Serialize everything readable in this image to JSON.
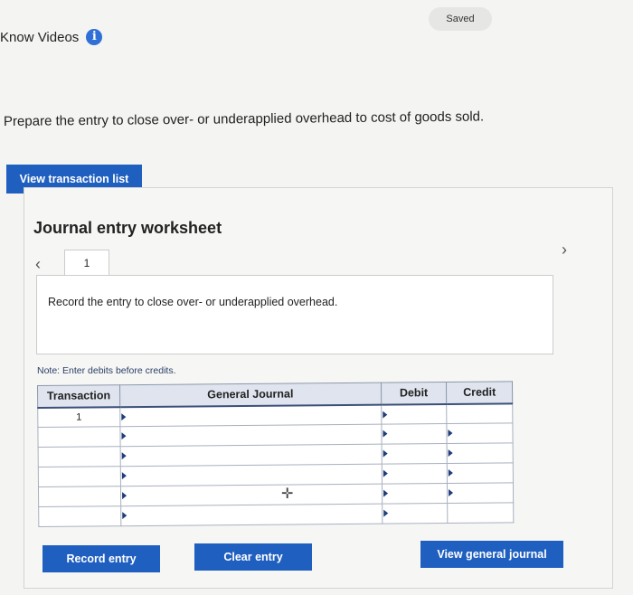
{
  "header": {
    "saved_label": "Saved",
    "know_videos_label": "Know Videos",
    "info_icon": "info-icon"
  },
  "question": {
    "prompt": "Prepare the entry to close over- or underapplied overhead to cost of goods sold."
  },
  "buttons": {
    "view_transaction_list": "View transaction list",
    "record_entry": "Record entry",
    "clear_entry": "Clear entry",
    "view_general_journal": "View general journal"
  },
  "worksheet": {
    "title": "Journal entry worksheet",
    "prev_icon": "chevron-left-icon",
    "next_icon": "chevron-right-icon",
    "tabs": [
      {
        "label": "1"
      }
    ],
    "entry_description": "Record the entry to close over- or underapplied overhead.",
    "note": "Note: Enter debits before credits."
  },
  "journal": {
    "columns": [
      "Transaction",
      "General Journal",
      "Debit",
      "Credit"
    ],
    "rows": [
      {
        "transaction": "1",
        "account": "",
        "debit": "",
        "credit": ""
      },
      {
        "transaction": "",
        "account": "",
        "debit": "",
        "credit": ""
      },
      {
        "transaction": "",
        "account": "",
        "debit": "",
        "credit": ""
      },
      {
        "transaction": "",
        "account": "",
        "debit": "",
        "credit": ""
      },
      {
        "transaction": "",
        "account": "",
        "debit": "",
        "credit": ""
      },
      {
        "transaction": "",
        "account": "",
        "debit": "",
        "credit": ""
      }
    ]
  },
  "colors": {
    "accent": "#1f5fbf",
    "info_icon": "#2f6fd6",
    "header_fill": "#dfe4ee"
  }
}
